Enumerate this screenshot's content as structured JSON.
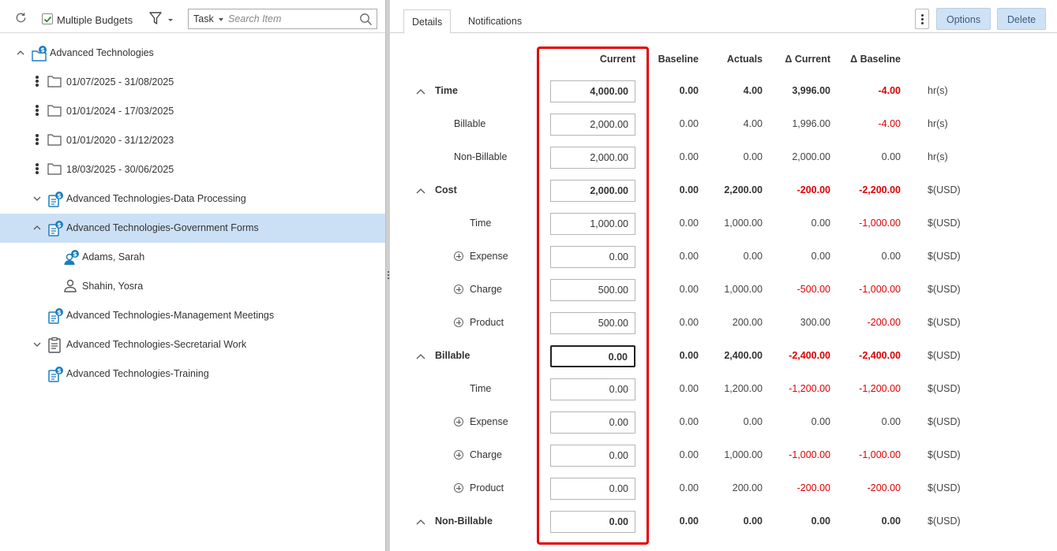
{
  "left": {
    "multiple_budgets_label": "Multiple Budgets",
    "multiple_budgets_checked": true,
    "search": {
      "type": "Task",
      "placeholder": "Search Item"
    },
    "tree": [
      {
        "label": "Advanced Technologies",
        "icon": "budget-folder-icon"
      },
      {
        "label": "01/07/2025 - 31/08/2025",
        "icon": "folder-icon"
      },
      {
        "label": "01/01/2024 - 17/03/2025",
        "icon": "folder-icon"
      },
      {
        "label": "01/01/2020 - 31/12/2023",
        "icon": "folder-icon"
      },
      {
        "label": "18/03/2025 - 30/06/2025",
        "icon": "folder-icon"
      },
      {
        "label": "Advanced Technologies-Data Processing",
        "icon": "budget-task-icon"
      },
      {
        "label": "Advanced Technologies-Government Forms",
        "icon": "budget-task-icon",
        "selected": true
      },
      {
        "label": "Adams, Sarah",
        "icon": "budget-user-icon"
      },
      {
        "label": "Shahin, Yosra",
        "icon": "user-icon"
      },
      {
        "label": "Advanced Technologies-Management Meetings",
        "icon": "budget-task-icon"
      },
      {
        "label": "Advanced Technologies-Secretarial Work",
        "icon": "task-icon"
      },
      {
        "label": "Advanced Technologies-Training",
        "icon": "budget-task-icon"
      }
    ]
  },
  "right": {
    "tabs": [
      {
        "label": "Details",
        "active": true
      },
      {
        "label": "Notifications"
      }
    ],
    "buttons": {
      "options": "Options",
      "delete": "Delete"
    },
    "columns": {
      "current": "Current",
      "baseline": "Baseline",
      "actuals": "Actuals",
      "delta_current": "Δ Current",
      "delta_baseline": "Δ Baseline"
    },
    "rows": [
      {
        "label": "Time",
        "current": "4,000.00",
        "baseline": "0.00",
        "actuals": "4.00",
        "delta_current": "3,996.00",
        "delta_baseline": "-4.00",
        "unit": "hr(s)"
      },
      {
        "label": "Billable",
        "current": "2,000.00",
        "baseline": "0.00",
        "actuals": "4.00",
        "delta_current": "1,996.00",
        "delta_baseline": "-4.00",
        "unit": "hr(s)"
      },
      {
        "label": "Non-Billable",
        "current": "2,000.00",
        "baseline": "0.00",
        "actuals": "0.00",
        "delta_current": "2,000.00",
        "delta_baseline": "0.00",
        "unit": "hr(s)"
      },
      {
        "label": "Cost",
        "current": "2,000.00",
        "baseline": "0.00",
        "actuals": "2,200.00",
        "delta_current": "-200.00",
        "delta_baseline": "-2,200.00",
        "unit": "$(USD)"
      },
      {
        "label": "Time",
        "current": "1,000.00",
        "baseline": "0.00",
        "actuals": "1,000.00",
        "delta_current": "0.00",
        "delta_baseline": "-1,000.00",
        "unit": "$(USD)"
      },
      {
        "label": "Expense",
        "current": "0.00",
        "baseline": "0.00",
        "actuals": "0.00",
        "delta_current": "0.00",
        "delta_baseline": "0.00",
        "unit": "$(USD)"
      },
      {
        "label": "Charge",
        "current": "500.00",
        "baseline": "0.00",
        "actuals": "1,000.00",
        "delta_current": "-500.00",
        "delta_baseline": "-1,000.00",
        "unit": "$(USD)"
      },
      {
        "label": "Product",
        "current": "500.00",
        "baseline": "0.00",
        "actuals": "200.00",
        "delta_current": "300.00",
        "delta_baseline": "-200.00",
        "unit": "$(USD)"
      },
      {
        "label": "Billable",
        "current": "0.00",
        "baseline": "0.00",
        "actuals": "2,400.00",
        "delta_current": "-2,400.00",
        "delta_baseline": "-2,400.00",
        "unit": "$(USD)"
      },
      {
        "label": "Time",
        "current": "0.00",
        "baseline": "0.00",
        "actuals": "1,200.00",
        "delta_current": "-1,200.00",
        "delta_baseline": "-1,200.00",
        "unit": "$(USD)"
      },
      {
        "label": "Expense",
        "current": "0.00",
        "baseline": "0.00",
        "actuals": "0.00",
        "delta_current": "0.00",
        "delta_baseline": "0.00",
        "unit": "$(USD)"
      },
      {
        "label": "Charge",
        "current": "0.00",
        "baseline": "0.00",
        "actuals": "1,000.00",
        "delta_current": "-1,000.00",
        "delta_baseline": "-1,000.00",
        "unit": "$(USD)"
      },
      {
        "label": "Product",
        "current": "0.00",
        "baseline": "0.00",
        "actuals": "200.00",
        "delta_current": "-200.00",
        "delta_baseline": "-200.00",
        "unit": "$(USD)"
      },
      {
        "label": "Non-Billable",
        "current": "0.00",
        "baseline": "0.00",
        "actuals": "0.00",
        "delta_current": "0.00",
        "delta_baseline": "0.00",
        "unit": "$(USD)"
      }
    ]
  },
  "colors": {
    "accent": "#1a7fc1",
    "negative": "#e00000",
    "selected_row": "#cce0f5",
    "highlight_box": "#e00000",
    "button_bg": "#cfe2f5"
  }
}
